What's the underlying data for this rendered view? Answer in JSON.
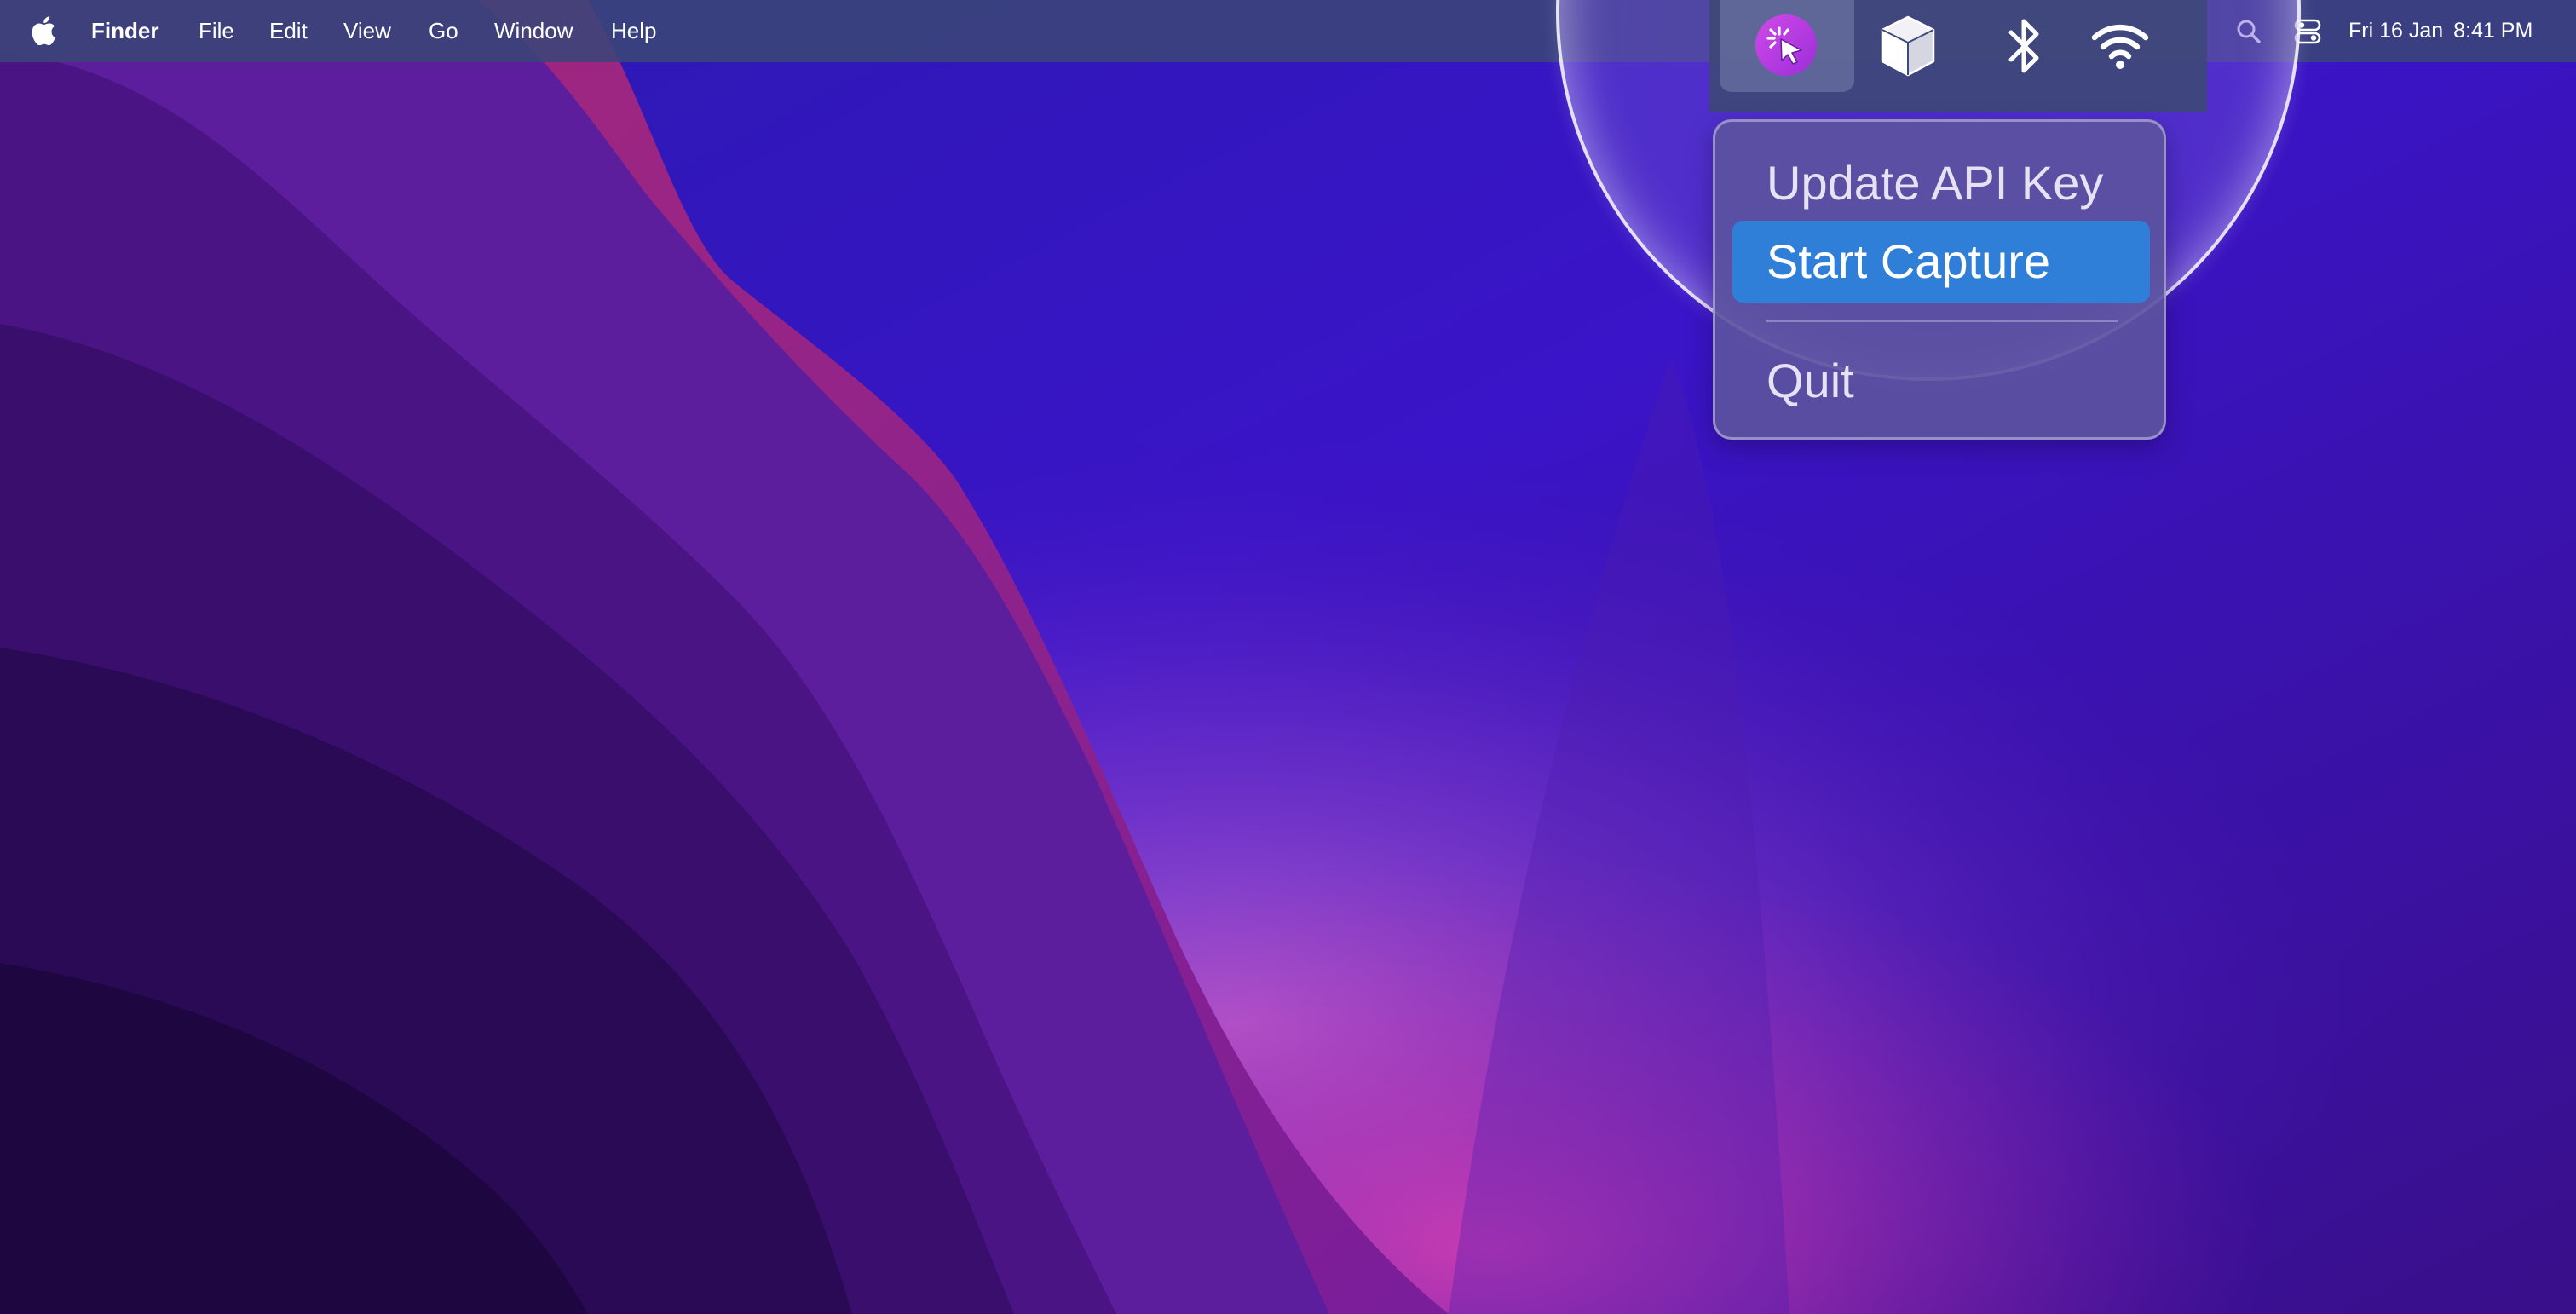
{
  "menubar": {
    "app_name": "Finder",
    "menus": [
      "File",
      "Edit",
      "View",
      "Go",
      "Window",
      "Help"
    ],
    "clock_date": "Fri 16 Jan",
    "clock_time": "8:41 PM"
  },
  "status_icons": [
    "app-cursor-icon",
    "box-icon",
    "bluetooth-icon",
    "wifi-icon",
    "search-icon",
    "control-center-icon"
  ],
  "dropdown": {
    "items": [
      "Update API Key",
      "Start Capture",
      "Quit"
    ],
    "highlighted": "Start Capture"
  },
  "colors": {
    "menubar": "#3a4678",
    "highlight": "#2f7ed8",
    "app_icon": "#b040e0",
    "wallpaper_primary": "#3a1aa8",
    "wallpaper_accent": "#c02a8a"
  }
}
